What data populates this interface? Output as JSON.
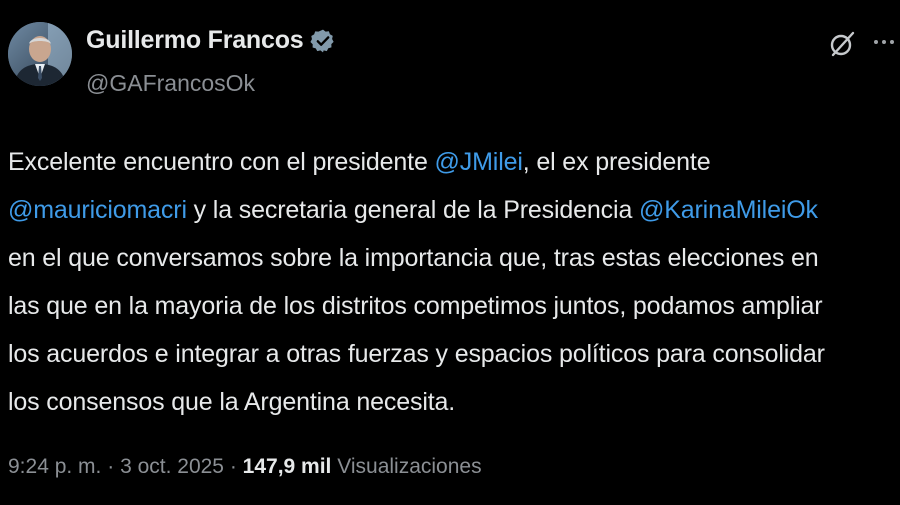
{
  "author": {
    "display_name": "Guillermo Francos",
    "handle": "@GAFrancosOk",
    "verified": true
  },
  "icons": {
    "verified": "verified-badge-icon",
    "grok": "grok-slash-icon",
    "more": "more-dots-icon",
    "avatar": "profile-photo"
  },
  "tweet": {
    "lines": [
      [
        {
          "text": "Excelente encuentro con el presidente ",
          "type": "text"
        },
        {
          "text": "@JMilei",
          "type": "mention"
        },
        {
          "text": ", el ex presidente",
          "type": "text"
        }
      ],
      [
        {
          "text": "@mauriciomacri",
          "type": "mention"
        },
        {
          "text": " y la secretaria general de la Presidencia ",
          "type": "text"
        },
        {
          "text": "@KarinaMileiOk",
          "type": "mention"
        }
      ],
      [
        {
          "text": "en el que conversamos sobre la importancia que, tras estas elecciones en",
          "type": "text"
        }
      ],
      [
        {
          "text": "las que en la mayoria de los distritos competimos juntos, podamos ampliar",
          "type": "text"
        }
      ],
      [
        {
          "text": "los acuerdos e integrar a otras fuerzas y espacios políticos para consolidar",
          "type": "text"
        }
      ],
      [
        {
          "text": "los consensos que la Argentina necesita.",
          "type": "text"
        }
      ]
    ]
  },
  "meta": {
    "time": "9:24 p. m.",
    "separator": " · ",
    "date": "3 oct. 2025",
    "views_count": "147,9 mil",
    "views_label": "Visualizaciones"
  },
  "colors": {
    "background": "#000000",
    "text": "#e7e9ea",
    "secondary": "#8b8f94",
    "mention": "#3f9be8",
    "verified_badge": "#829aab"
  }
}
